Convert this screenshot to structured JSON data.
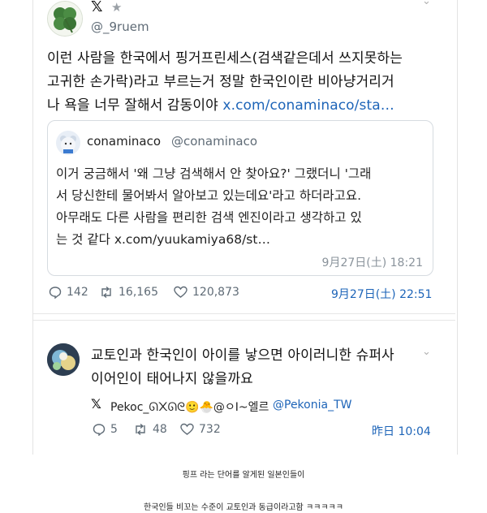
{
  "post1": {
    "service_mark": "𝕏",
    "star_icon": "star-icon",
    "handle": "@_9ruem",
    "text_lines": [
      "이런 사람을 한국에서 핑거프린세스(검색같은데서 쓰지못하는",
      "고귀한 손가락)라고 부르는거 정말 한국인이란 비아냥거리거",
      "나 욕을 너무 잘해서 감동이야 "
    ],
    "link": "x.com/conaminaco/sta…",
    "quote": {
      "name": "conaminaco",
      "handle": "@conaminaco",
      "text_lines": [
        "이거 궁금해서 '왜 그냥 검색해서 안 찾아요?' 그랬더니 '그래",
        "서 당신한테 물어봐서 알아보고 있는데요'라고 하더라고요.",
        "아무래도 다른 사람을 편리한 검색 엔진이라고 생각하고 있",
        "는 것 같다 "
      ],
      "link": "x.com/yuukamiya68/st…",
      "timestamp": "9月27日(土) 18:21"
    },
    "replies": "142",
    "retweets": "16,165",
    "likes": "120,873",
    "timestamp": "9月27日(土) 22:51"
  },
  "post2": {
    "text_lines": [
      "교토인과 한국인이 아이를 낳으면 아이러니한 슈퍼사",
      "이어인이 태어나지 않을까요"
    ],
    "service_mark": "𝕏",
    "author_name": "Pekoc_ᘏ᙭ᘏᘓ🙂🐣@ㅇI~엘르",
    "handle": "@Pekonia_TW",
    "replies": "5",
    "retweets": "48",
    "likes": "732",
    "timestamp": "昨日 10:04"
  },
  "captions": [
    "핑프 라는 단어를 알게된 일본인들이",
    "한국인들 비꼬는 수준이 교토인과 동급이라고함 ㅋㅋㅋㅋㅋ"
  ],
  "colors": {
    "link": "#1d64b8",
    "meta_gray": "#5f6b76",
    "border": "#d6dbe0"
  }
}
